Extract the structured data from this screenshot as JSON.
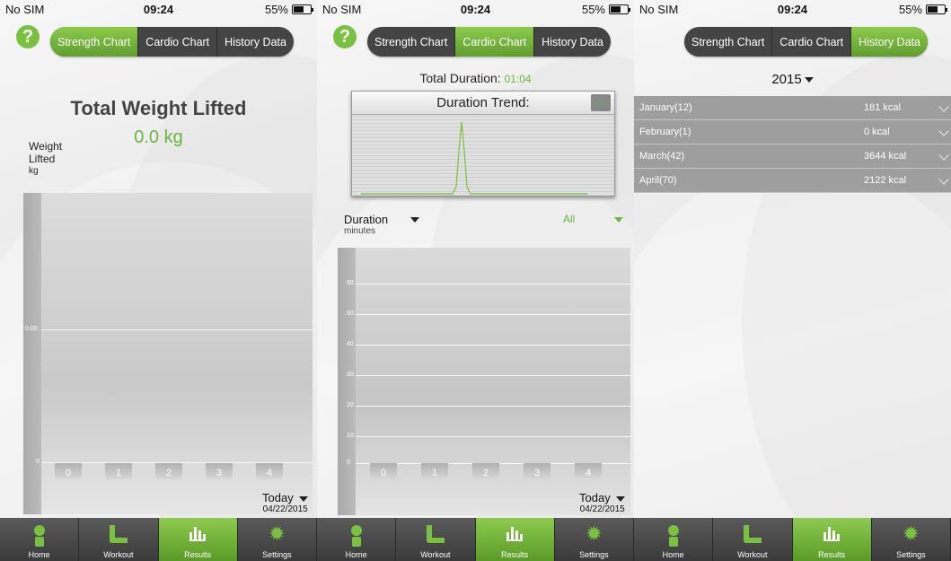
{
  "status": {
    "carrier": "No SIM",
    "time": "09:24",
    "battery": "55%"
  },
  "segments": {
    "strength": "Strength Chart",
    "cardio": "Cardio Chart",
    "history": "History Data"
  },
  "help": {
    "label": "?"
  },
  "strength": {
    "title": "Total Weight Lifted",
    "value": "0.0 kg",
    "ylabel_line1": "Weight",
    "ylabel_line2": "Lifted",
    "ylabel_unit": "kg",
    "ticks": [
      "0.00",
      "0"
    ],
    "categories": [
      "0",
      "1",
      "2",
      "3",
      "4"
    ],
    "today_label": "Today",
    "today_date": "04/22/2015"
  },
  "cardio": {
    "total_label": "Total Duration:",
    "total_value": "01:04",
    "trend_title": "Duration Trend:",
    "metric": "Duration",
    "metric_unit": "minutes",
    "filter": "All",
    "ticks": [
      "60",
      "50",
      "40",
      "30",
      "20",
      "10",
      "0"
    ],
    "categories": [
      "0",
      "1",
      "2",
      "3",
      "4"
    ],
    "today_label": "Today",
    "today_date": "04/22/2015"
  },
  "history": {
    "year": "2015",
    "rows": [
      {
        "month": "January(12)",
        "kcal": "181 kcal"
      },
      {
        "month": "February(1)",
        "kcal": "0 kcal"
      },
      {
        "month": "March(42)",
        "kcal": "3644 kcal"
      },
      {
        "month": "April(70)",
        "kcal": "2122 kcal"
      }
    ]
  },
  "tabs": {
    "home": "Home",
    "workout": "Workout",
    "results": "Results",
    "settings": "Settings"
  },
  "colors": {
    "accent": "#6cb33f",
    "tabbar": "#444444"
  }
}
